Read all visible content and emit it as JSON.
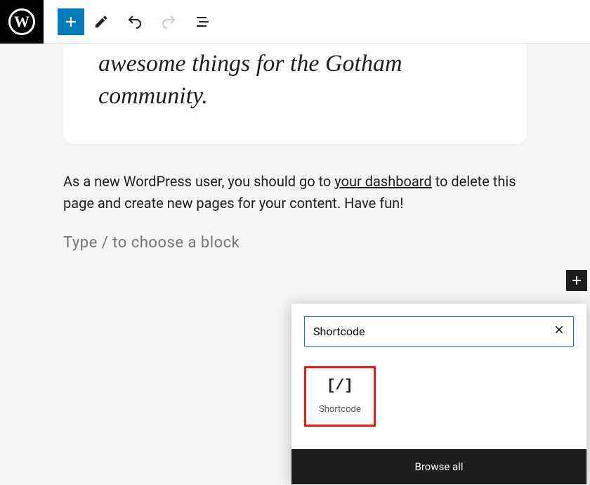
{
  "toolbar": {
    "logo": "W"
  },
  "quote": {
    "text": "awesome things for the Gotham community."
  },
  "paragraph": {
    "prefix": "As a new WordPress user, you should go to ",
    "link_text": "your dashboard",
    "suffix": " to delete this page and create new pages for your content. Have fun!"
  },
  "placeholder": {
    "text": "Type / to choose a block"
  },
  "inserter": {
    "search_value": "Shortcode",
    "results": [
      {
        "icon": "[/]",
        "label": "Shortcode"
      }
    ],
    "browse_all": "Browse all"
  }
}
